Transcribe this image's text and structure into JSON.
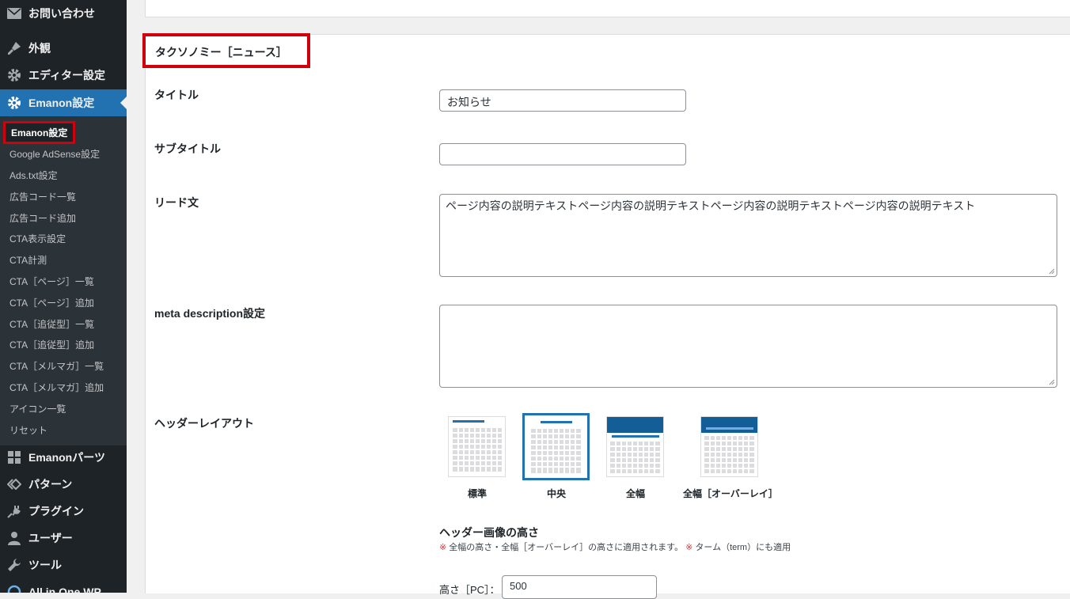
{
  "sidebar": {
    "menu_top": [
      {
        "label": "お問い合わせ",
        "icon": "mail-icon"
      },
      {
        "label": "外観",
        "icon": "brush-icon"
      },
      {
        "label": "エディター設定",
        "icon": "gear-icon"
      },
      {
        "label": "Emanon設定",
        "icon": "gear-icon"
      }
    ],
    "submenu": [
      "Emanon設定",
      "Google AdSense設定",
      "Ads.txt設定",
      "広告コード一覧",
      "広告コード追加",
      "CTA表示設定",
      "CTA計測",
      "CTA［ページ］一覧",
      "CTA［ページ］追加",
      "CTA［追従型］一覧",
      "CTA［追従型］追加",
      "CTA［メルマガ］一覧",
      "CTA［メルマガ］追加",
      "アイコン一覧",
      "リセット"
    ],
    "menu_bottom": [
      {
        "label": "Emanonパーツ",
        "icon": "grid-icon"
      },
      {
        "label": "パターン",
        "icon": "diamond-icon"
      },
      {
        "label": "プラグイン",
        "icon": "plug-icon"
      },
      {
        "label": "ユーザー",
        "icon": "user-icon"
      },
      {
        "label": "ツール",
        "icon": "wrench-icon"
      },
      {
        "label": "All in One WP",
        "icon": "shield-icon"
      }
    ],
    "accent": "#2271b1",
    "highlight": "#d1000d"
  },
  "form": {
    "section_title": "タクソノミー［ニュース］",
    "title_label": "タイトル",
    "title_value": "お知らせ",
    "subtitle_label": "サブタイトル",
    "subtitle_value": "",
    "lead_label": "リード文",
    "lead_value": "ページ内容の説明テキストページ内容の説明テキストページ内容の説明テキストページ内容の説明テキスト",
    "meta_label": "meta description設定",
    "meta_value": "",
    "header_layout_label": "ヘッダーレイアウト",
    "layouts": [
      {
        "label": "標準",
        "selected": false
      },
      {
        "label": "中央",
        "selected": true
      },
      {
        "label": "全幅",
        "selected": false
      },
      {
        "label": "全幅［オーバーレイ］",
        "selected": false
      }
    ],
    "image_height_heading": "ヘッダー画像の高さ",
    "note_mark": "※",
    "note_part1": "全幅の高さ・全幅［オーバーレイ］の高さに適用されます。",
    "note_part2": "ターム（term）にも適用",
    "height_pc_label": "高さ［PC］：",
    "height_pc_value": "500"
  }
}
